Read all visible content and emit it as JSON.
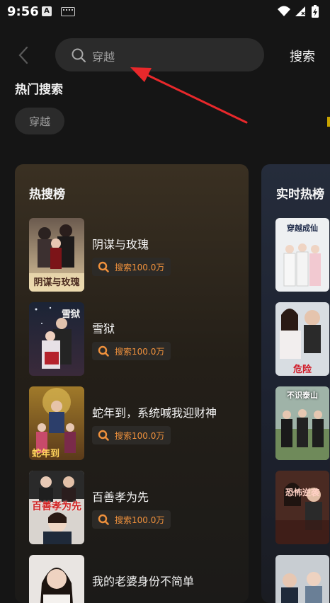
{
  "status_bar": {
    "time": "9:56",
    "notif_a": "A",
    "icons": [
      "keyboard-icon",
      "wifi-icon",
      "signal-icon",
      "battery-icon"
    ]
  },
  "header": {
    "back_icon": "chevron-left-icon",
    "search_placeholder": "穿越",
    "search_button": "搜索"
  },
  "history": {
    "title": "热门搜索",
    "chips": [
      "穿越"
    ]
  },
  "hot_list": {
    "title": "热搜榜",
    "items": [
      {
        "title": "阴谋与玫瑰",
        "count": "搜索100.0万",
        "poster_text": "阴谋与玫瑰"
      },
      {
        "title": "雪狱",
        "count": "搜索100.0万",
        "poster_text": "雪狱"
      },
      {
        "title": "蛇年到，系统喊我迎财神",
        "count": "搜索100.0万",
        "poster_text": "蛇年到"
      },
      {
        "title": "百善孝为先",
        "count": "搜索100.0万",
        "poster_text": "百善孝为先"
      },
      {
        "title": "我的老婆身份不简单",
        "count": "",
        "poster_text": ""
      }
    ]
  },
  "realtime_list": {
    "title": "实时热榜",
    "posters": [
      "穿越成仙",
      "危险",
      "不识泰山",
      "恐怖逆袭",
      ""
    ]
  },
  "colors": {
    "background": "#151515",
    "accent_orange": "#f0913c",
    "annotation_arrow": "#e8282b"
  }
}
